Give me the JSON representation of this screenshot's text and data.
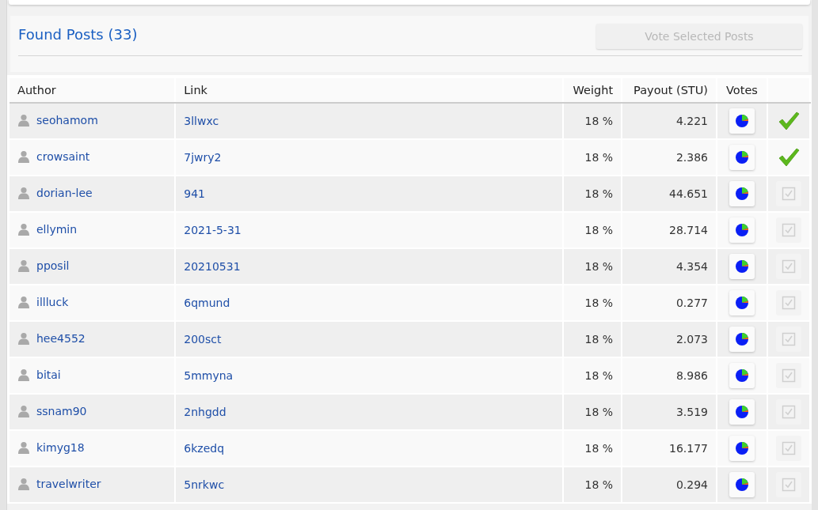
{
  "panel": {
    "title": "Found Posts (33)",
    "vote_button": {
      "label": "Vote Selected Posts",
      "disabled": true
    }
  },
  "table": {
    "columns": [
      "Author",
      "Link",
      "Weight",
      "Payout (STU)",
      "Votes"
    ],
    "rows": [
      {
        "author": "seohamom",
        "link": "3llwxc",
        "weight": "18 %",
        "payout": "4.221",
        "voted": true
      },
      {
        "author": "crowsaint",
        "link": "7jwry2",
        "weight": "18 %",
        "payout": "2.386",
        "voted": true
      },
      {
        "author": "dorian-lee",
        "link": "941",
        "weight": "18 %",
        "payout": "44.651",
        "voted": false
      },
      {
        "author": "ellymin",
        "link": "2021-5-31",
        "weight": "18 %",
        "payout": "28.714",
        "voted": false
      },
      {
        "author": "pposil",
        "link": "20210531",
        "weight": "18 %",
        "payout": "4.354",
        "voted": false
      },
      {
        "author": "illluck",
        "link": "6qmund",
        "weight": "18 %",
        "payout": "0.277",
        "voted": false
      },
      {
        "author": "hee4552",
        "link": "200sct",
        "weight": "18 %",
        "payout": "2.073",
        "voted": false
      },
      {
        "author": "bitai",
        "link": "5mmyna",
        "weight": "18 %",
        "payout": "8.986",
        "voted": false
      },
      {
        "author": "ssnam90",
        "link": "2nhgdd",
        "weight": "18 %",
        "payout": "3.519",
        "voted": false
      },
      {
        "author": "kimyg18",
        "link": "6kzedq",
        "weight": "18 %",
        "payout": "16.177",
        "voted": false
      },
      {
        "author": "travelwriter",
        "link": "5nrkwc",
        "weight": "18 %",
        "payout": "0.294",
        "voted": false
      }
    ]
  }
}
